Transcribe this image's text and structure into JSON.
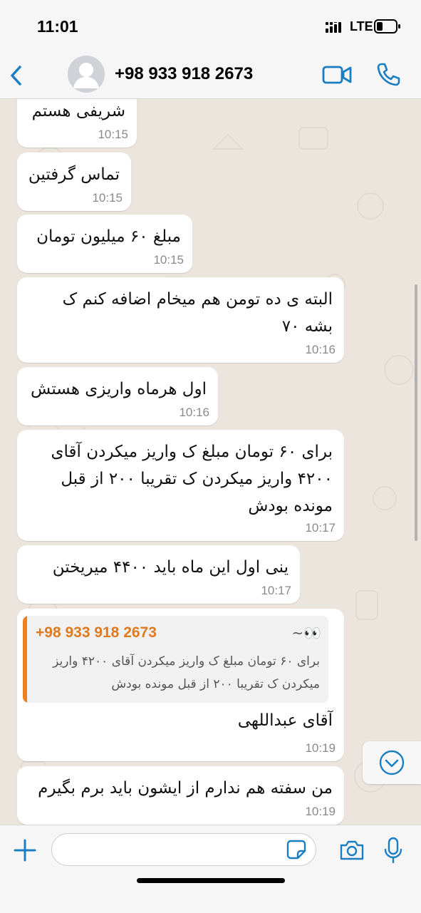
{
  "status_bar": {
    "time": "11:01",
    "network": "LTE"
  },
  "header": {
    "contact_name": "+98 933 918 2673",
    "icons": [
      "chevron-left-icon",
      "avatar",
      "video-camera-icon",
      "phone-icon"
    ],
    "accent_color": "#1b7ec2"
  },
  "messages": [
    {
      "text": "شریفی هستم",
      "time": "10:15"
    },
    {
      "text": "تماس گرفتین",
      "time": "10:15"
    },
    {
      "text": "مبلغ ۶۰ میلیون تومان",
      "time": "10:15"
    },
    {
      "lines": [
        "البته ی ده تومن هم میخام اضافه کنم ک",
        "بشه ۷۰"
      ],
      "time": "10:16"
    },
    {
      "text": "اول هرماه واریزی هستش",
      "time": "10:16"
    },
    {
      "lines": [
        "برای ۶۰ تومان مبلغ ک واریز میکردن آقای",
        "۴۲۰۰ واریز میکردن ک تقریبا ۲۰۰ از قبل",
        "مونده بودش"
      ],
      "time": "10:17"
    },
    {
      "text": "ینی اول این ماه باید ۴۴۰۰ میریختن",
      "time": "10:17"
    },
    {
      "reply": {
        "author": "+98 933 918 2673",
        "author_suffix": "~👀",
        "lines": [
          "برای ۶۰ تومان مبلغ ک واریز میکردن آقای ۴۲۰۰ واریز",
          "میکردن ک تقریبا ۲۰۰ از قبل مونده بودش"
        ],
        "accent_color": "#f0801e"
      },
      "text": "آقای عبداللهی",
      "time": "10:19"
    },
    {
      "text": "من سفته هم ندارم از ایشون باید برم بگیرم",
      "time": "10:19"
    }
  ],
  "input_bar": {
    "placeholder": "",
    "icons": [
      "plus-icon",
      "sticker-icon",
      "camera-icon",
      "microphone-icon"
    ]
  },
  "scroll_button_icon": "chevron-down-icon"
}
